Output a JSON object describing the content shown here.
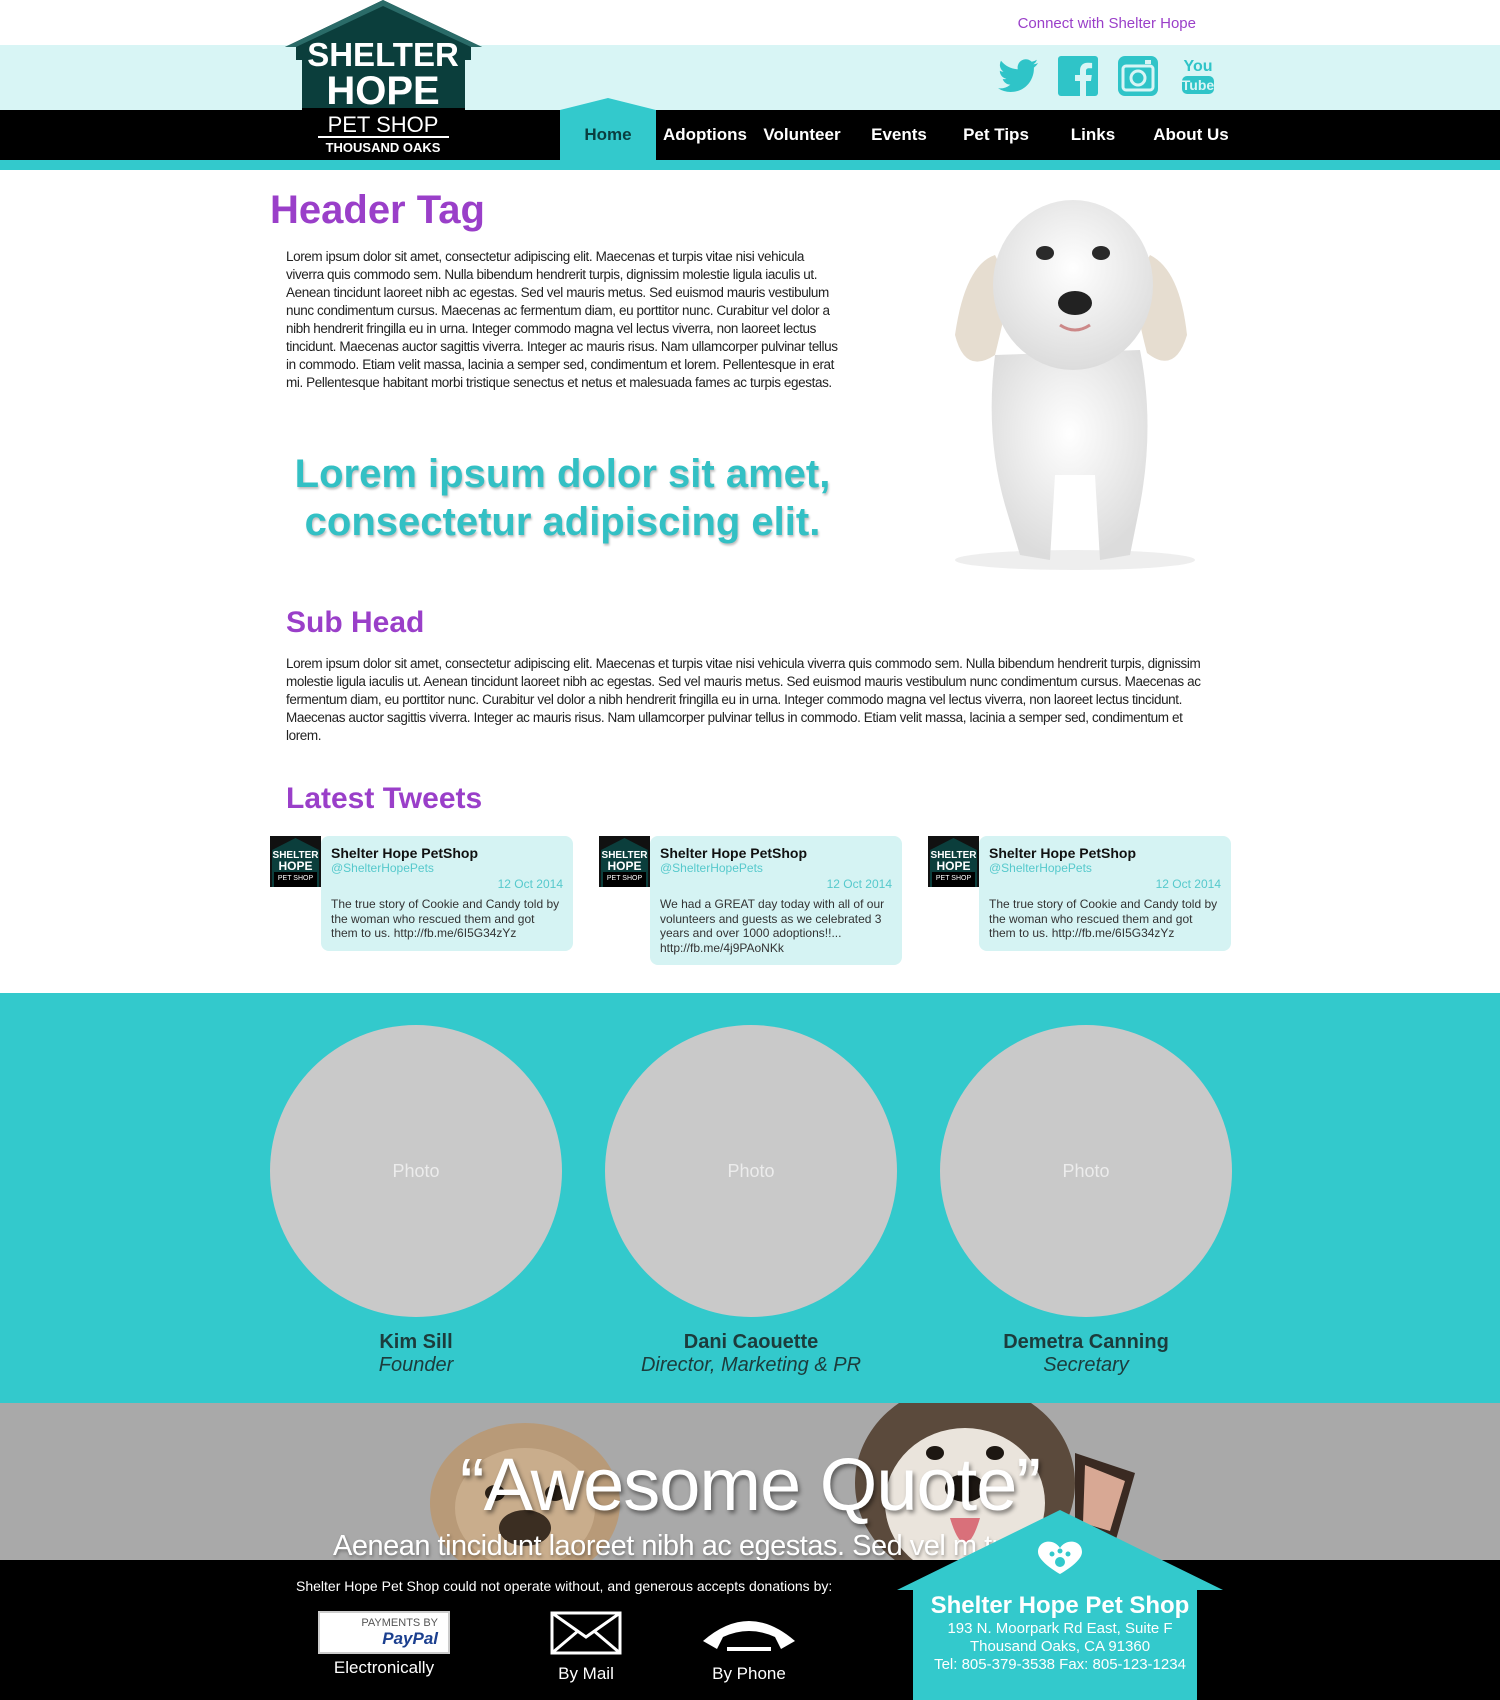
{
  "header": {
    "connect_text": "Connect with Shelter Hope",
    "logo": {
      "line1": "SHELTER",
      "line2": "HOPE",
      "line3": "PET SHOP",
      "line4": "THOUSAND OAKS"
    },
    "social": [
      {
        "name": "twitter-icon"
      },
      {
        "name": "facebook-icon"
      },
      {
        "name": "instagram-icon"
      },
      {
        "name": "youtube-icon",
        "text1": "You",
        "text2": "Tube"
      }
    ],
    "nav": [
      {
        "label": "Home",
        "active": true
      },
      {
        "label": "Adoptions"
      },
      {
        "label": "Volunteer"
      },
      {
        "label": "Events"
      },
      {
        "label": "Pet Tips"
      },
      {
        "label": "Links"
      },
      {
        "label": "About Us"
      }
    ]
  },
  "main": {
    "header_tag": "Header Tag",
    "paragraph1": "Lorem ipsum dolor sit amet, consectetur adipiscing elit. Maecenas et turpis vitae nisi vehicula viverra quis commodo sem. Nulla bibendum hendrerit turpis, dignissim molestie ligula iaculis ut. Aenean tincidunt laoreet nibh ac egestas. Sed vel mauris metus. Sed euismod mauris vestibulum nunc condimentum cursus. Maecenas ac fermentum diam, eu porttitor nunc. Curabitur vel dolor a nibh hendrerit fringilla eu in urna. Integer commodo magna vel lectus viverra, non laoreet lectus tincidunt. Maecenas auctor sagittis viverra. Integer ac mauris risus. Nam ullamcorper pulvinar tellus in commodo. Etiam velit massa, lacinia a semper sed, condimentum et lorem. Pellentesque in erat mi. Pellentesque habitant morbi tristique senectus et netus et malesuada fames ac turpis egestas.",
    "big_quote_line1": "Lorem ipsum dolor sit amet,",
    "big_quote_line2": "consectetur adipiscing elit.",
    "sub_head": "Sub Head",
    "paragraph2": "Lorem ipsum dolor sit amet, consectetur adipiscing elit. Maecenas et turpis vitae nisi vehicula viverra quis commodo sem. Nulla bibendum hendrerit turpis, dignissim molestie ligula iaculis ut. Aenean tincidunt laoreet nibh ac egestas. Sed vel mauris metus. Sed euismod mauris vestibulum nunc condimentum cursus. Maecenas ac fermentum diam, eu porttitor nunc. Curabitur vel dolor a nibh hendrerit fringilla eu in urna. Integer commodo magna vel lectus viverra, non laoreet lectus tincidunt. Maecenas auctor sagittis viverra. Integer ac mauris risus. Nam ullamcorper pulvinar tellus in commodo. Etiam velit massa, lacinia a semper sed, condimentum et lorem."
  },
  "tweets": {
    "heading": "Latest Tweets",
    "items": [
      {
        "name": "Shelter Hope PetShop",
        "handle": "@ShelterHopePets",
        "date": "12 Oct 2014",
        "text": "The true story of Cookie and Candy told by the woman who rescued them and got them to us. http://fb.me/6I5G34zYz"
      },
      {
        "name": "Shelter Hope PetShop",
        "handle": "@ShelterHopePets",
        "date": "12 Oct 2014",
        "text": "We had a GREAT day today with all of our volunteers and guests as we celebrated 3 years and over 1000 adoptions!!... http://fb.me/4j9PAoNKk"
      },
      {
        "name": "Shelter Hope PetShop",
        "handle": "@ShelterHopePets",
        "date": "12 Oct 2014",
        "text": "The true story of Cookie and Candy told by the woman who rescued them and got them to us. http://fb.me/6I5G34zYz"
      }
    ]
  },
  "team": [
    {
      "photo": "Photo",
      "name": "Kim Sill",
      "role": "Founder"
    },
    {
      "photo": "Photo",
      "name": "Dani Caouette",
      "role": "Director, Marketing & PR"
    },
    {
      "photo": "Photo",
      "name": "Demetra Canning",
      "role": "Secretary"
    }
  ],
  "quote": {
    "title": "“Awesome Quote”",
    "subtitle": "Aenean tincidunt laoreet nibh ac egestas. Sed vel m            tus."
  },
  "footer": {
    "donate_text": "Shelter Hope Pet Shop could not operate without, and generous accepts donations by:",
    "donations": [
      {
        "label": "Electronically",
        "badge_top": "PAYMENTS BY",
        "badge_brand": "PayPal"
      },
      {
        "label": "By Mail"
      },
      {
        "label": "By Phone"
      }
    ],
    "contact": {
      "title": "Shelter Hope Pet Shop",
      "address1": "193 N. Moorpark Rd East, Suite F",
      "address2": "Thousand Oaks, CA 91360",
      "phone": "Tel: 805-379-3538  Fax: 805-123-1234"
    }
  },
  "colors": {
    "teal": "#33c9cc",
    "purple": "#9a3fc9",
    "light_teal": "#d8f5f5",
    "black": "#000000"
  }
}
